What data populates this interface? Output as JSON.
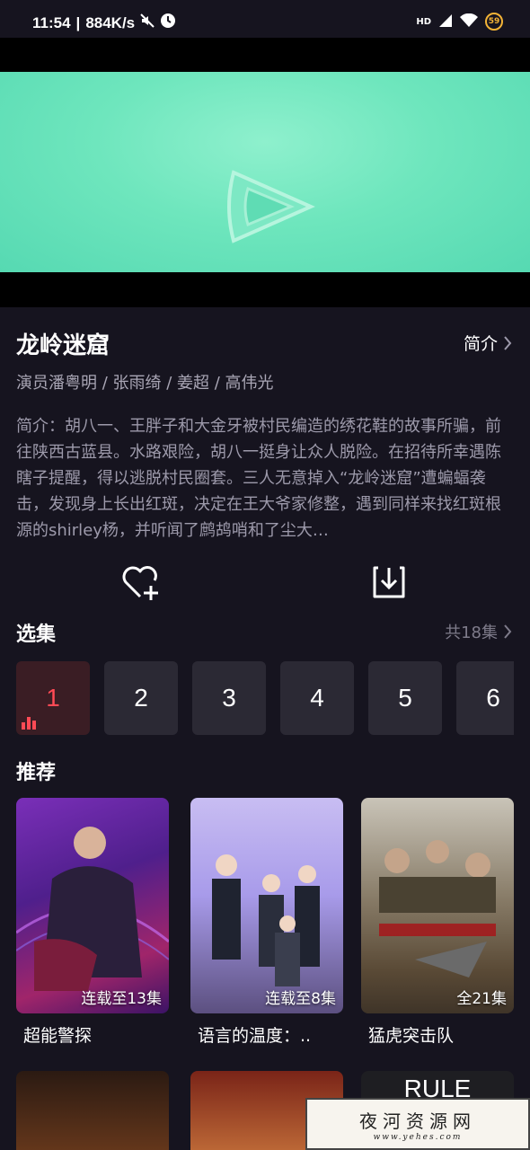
{
  "status_bar": {
    "time": "11:54",
    "speed": "884K/s",
    "network": "HD",
    "battery": "59"
  },
  "video": {
    "logo": "play-logo"
  },
  "detail": {
    "title": "龙岭迷窟",
    "intro_link": "简介",
    "cast": "演员潘粤明 / 张雨绮 / 姜超 / 高伟光",
    "synopsis": "简介：胡八一、王胖子和大金牙被村民编造的绣花鞋的故事所骗，前往陕西古蓝县。水路艰险，胡八一挺身让众人脱险。在招待所幸遇陈瞎子提醒，得以逃脱村民圈套。三人无意掉入“龙岭迷窟”遭蝙蝠袭击，发现身上长出红斑，决定在王大爷家修整，遇到同样来找红斑根源的shirley杨，并听闻了鹧鸪哨和了尘大…"
  },
  "episodes": {
    "title": "选集",
    "count": "共18集",
    "items": [
      "1",
      "2",
      "3",
      "4",
      "5",
      "6"
    ],
    "active": "1"
  },
  "recommend": {
    "title": "推荐",
    "items": [
      {
        "name": "超能警探",
        "badge": "连载至13集"
      },
      {
        "name": "语言的温度：..",
        "badge": "连载至8集"
      },
      {
        "name": "猛虎突击队",
        "badge": "全21集"
      }
    ],
    "row2_q3_text": "RULE"
  },
  "watermark": {
    "cn": "夜河资源网",
    "url": "www.yehes.com"
  },
  "colors": {
    "accent": "#ff4a55",
    "background": "#16141f",
    "tile": "#2b2934"
  }
}
